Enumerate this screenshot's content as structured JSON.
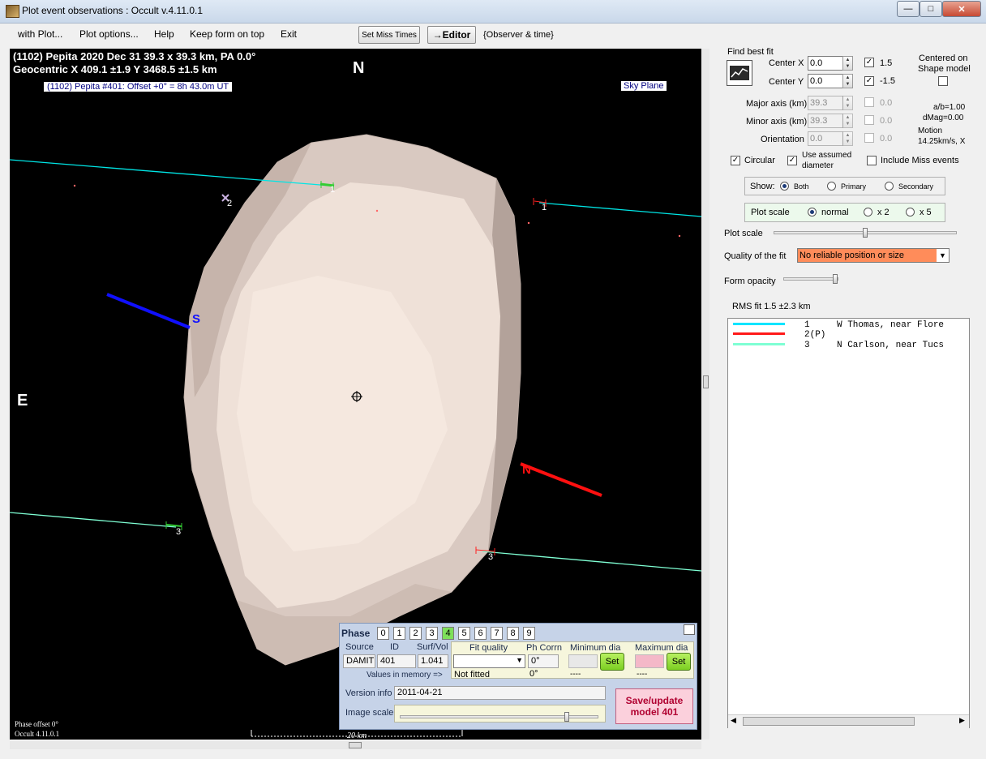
{
  "window": {
    "title": "Plot event observations : Occult v.4.11.0.1",
    "minimize_icon": "minimize-icon",
    "maximize_icon": "maximize-icon",
    "close_icon": "close-icon"
  },
  "menu": {
    "items": [
      "with Plot...",
      "Plot options...",
      "Help",
      "Keep form on top",
      "Exit"
    ],
    "set_miss_times": "Set Miss Times",
    "editor": "→Editor",
    "observer_time": "{Observer & time}"
  },
  "plot": {
    "header_line1": "(1102) Pepita  2020 Dec 31   39.3 x 39.3 km,  PA 0.0°",
    "header_line2": "Geocentric  X  409.1 ±1.9  Y 3468.5 ±1.5 km",
    "offset_label": "(1102) Pepita #401: Offset  +0° =  8h 43.0m UT",
    "sky_plane": "Sky Plane",
    "north": "N",
    "east": "E",
    "south_marker": "S",
    "north_marker": "N",
    "chord_labels": [
      "1",
      "1",
      "2",
      "3",
      "3"
    ],
    "phase_offset": "Phase offset 0°",
    "version_footer": "Occult 4.11.0.1",
    "scale_label": "20 km",
    "colors": {
      "chord1": "#00e5e5",
      "chord3": "#7fffd4",
      "shape": "#e8d8d0",
      "south_arrow": "#1010ff",
      "north_arrow": "#ff1010"
    }
  },
  "fit": {
    "find_best_fit": "Find best fit",
    "center_x_label": "Center X",
    "center_x": "0.0",
    "center_y_label": "Center Y",
    "center_y": "0.0",
    "cx_step": "1.5",
    "cy_step": "-1.5",
    "centered_on": "Centered on",
    "shape_model": "Shape model",
    "major_label": "Major axis (km)",
    "major": "39.3",
    "minor_label": "Minor axis (km)",
    "minor": "39.3",
    "orient_label": "Orientation",
    "orient": "0.0",
    "step_major": "0.0",
    "step_minor": "0.0",
    "step_orient": "0.0",
    "ab_ratio": "a/b=1.00",
    "dmag": "dMag=0.00",
    "motion": "Motion",
    "motion_val": "14.25km/s, X",
    "circular": "Circular",
    "use_assumed_1": "Use assumed",
    "use_assumed_2": "diameter",
    "include_miss": "Include Miss events",
    "show_label": "Show:",
    "show_options": [
      "Both",
      "Primary",
      "Secondary"
    ],
    "plot_scale_label": "Plot scale",
    "scale_options": [
      "normal",
      "x 2",
      "x 5"
    ],
    "plot_scale_slider": "Plot scale",
    "quality_label": "Quality of the fit",
    "quality_value": "No reliable position or size",
    "form_opacity": "Form opacity",
    "rms_fit": "RMS fit  1.5 ±2.3 km",
    "quality_color": "#ff8c5a"
  },
  "legend": {
    "rows": [
      {
        "num": "1",
        "name": "W Thomas, near Flore",
        "color": "#00e5ff"
      },
      {
        "num": "2(P)",
        "name": "",
        "color": "#ff1a1a"
      },
      {
        "num": "3",
        "name": "N Carlson, near Tucs",
        "color": "#7fffd4"
      }
    ]
  },
  "phase": {
    "title": "Phase",
    "buttons": [
      "0",
      "1",
      "2",
      "3",
      "4",
      "5",
      "6",
      "7",
      "8",
      "9"
    ],
    "active": 4,
    "source_hdr": "Source",
    "id_hdr": "ID",
    "surf_hdr": "Surf/Vol",
    "source": "DAMIT",
    "id": "401",
    "surf": "1.041",
    "values_in_memory": "Values in memory =>",
    "fit_quality_hdr": "Fit quality",
    "ph_corrn_hdr": "Ph Corrn",
    "min_dia_hdr": "Minimum dia",
    "max_dia_hdr": "Maximum dia",
    "ph_corrn": "0°",
    "fit_quality_mem": "Not fitted",
    "ph_corrn_mem": "0°",
    "min_dash": "----",
    "max_dash": "----",
    "set": "Set",
    "version_info_label": "Version info",
    "version_info": "2011-04-21",
    "image_scale_label": "Image scale",
    "save_update_1": "Save/update",
    "save_update_2": "model 401"
  }
}
